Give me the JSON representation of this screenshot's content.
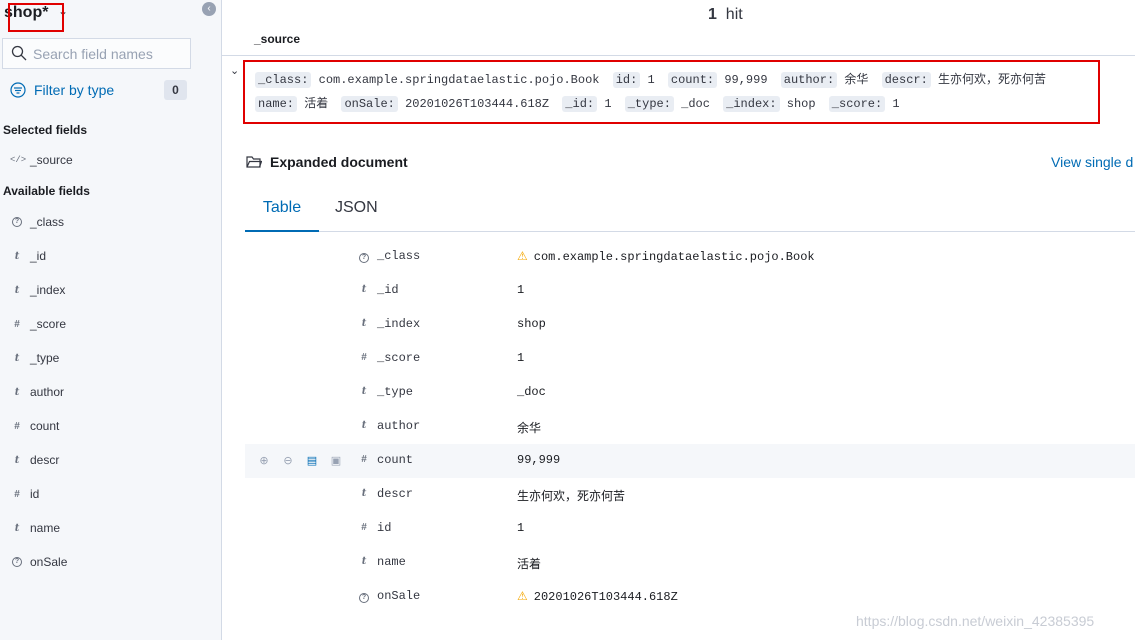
{
  "sidebar": {
    "index_pattern": "shop*",
    "search_placeholder": "Search field names",
    "filter_label": "Filter by type",
    "filter_count": "0",
    "selected_title": "Selected fields",
    "selected_fields": [
      {
        "name": "_source",
        "type": "code"
      }
    ],
    "available_title": "Available fields",
    "available_fields": [
      {
        "name": "_class",
        "type": "unknown"
      },
      {
        "name": "_id",
        "type": "string"
      },
      {
        "name": "_index",
        "type": "string"
      },
      {
        "name": "_score",
        "type": "number"
      },
      {
        "name": "_type",
        "type": "string"
      },
      {
        "name": "author",
        "type": "string"
      },
      {
        "name": "count",
        "type": "number"
      },
      {
        "name": "descr",
        "type": "string"
      },
      {
        "name": "id",
        "type": "number"
      },
      {
        "name": "name",
        "type": "string"
      },
      {
        "name": "onSale",
        "type": "unknown"
      }
    ]
  },
  "hits": {
    "count": "1",
    "label": "hit"
  },
  "source_column": "_source",
  "summary": [
    {
      "key": "_class:",
      "value": "com.example.springdataelastic.pojo.Book"
    },
    {
      "key": "id:",
      "value": "1"
    },
    {
      "key": "count:",
      "value": "99,999"
    },
    {
      "key": "author:",
      "value": "余华"
    },
    {
      "key": "descr:",
      "value": "生亦何欢，死亦何苦"
    },
    {
      "key": "name:",
      "value": "活着"
    },
    {
      "key": "onSale:",
      "value": "20201026T103444.618Z"
    },
    {
      "key": "_id:",
      "value": "1"
    },
    {
      "key": "_type:",
      "value": "_doc"
    },
    {
      "key": "_index:",
      "value": "shop"
    },
    {
      "key": "_score:",
      "value": "1"
    }
  ],
  "expanded": {
    "title": "Expanded document",
    "view_single": "View single d",
    "tabs": [
      "Table",
      "JSON"
    ]
  },
  "doc_rows": [
    {
      "field": "_class",
      "type": "unknown",
      "value": "com.example.springdataelastic.pojo.Book",
      "warn": true
    },
    {
      "field": "_id",
      "type": "string",
      "value": "1"
    },
    {
      "field": "_index",
      "type": "string",
      "value": "shop"
    },
    {
      "field": "_score",
      "type": "number",
      "value": "1"
    },
    {
      "field": "_type",
      "type": "string",
      "value": "_doc"
    },
    {
      "field": "author",
      "type": "string",
      "value": "余华"
    },
    {
      "field": "count",
      "type": "number",
      "value": "99,999",
      "hover": true
    },
    {
      "field": "descr",
      "type": "string",
      "value": "生亦何欢，死亦何苦"
    },
    {
      "field": "id",
      "type": "number",
      "value": "1"
    },
    {
      "field": "name",
      "type": "string",
      "value": "活着"
    },
    {
      "field": "onSale",
      "type": "unknown",
      "value": "20201026T103444.618Z",
      "warn": true
    }
  ],
  "watermark": "https://blog.csdn.net/weixin_42385395"
}
